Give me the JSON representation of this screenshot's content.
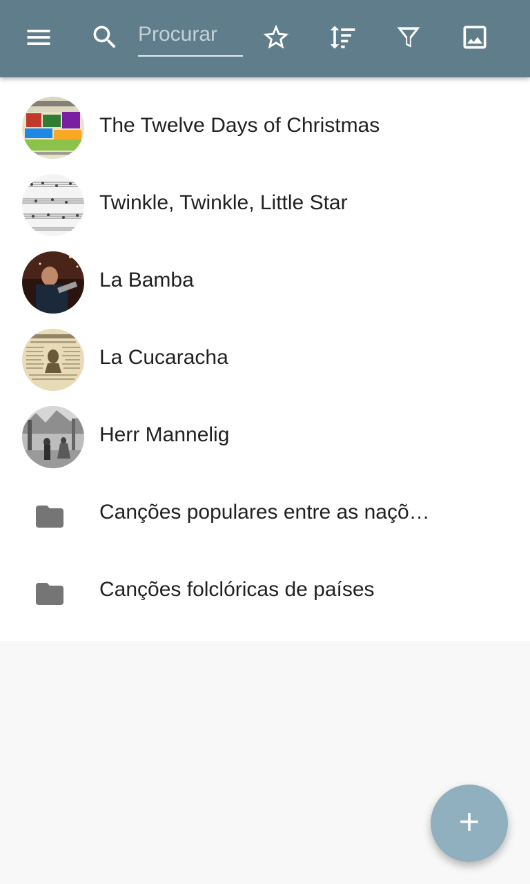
{
  "toolbar": {
    "menu_icon": "menu-icon",
    "search_icon": "search-icon",
    "search_placeholder": "Procurar",
    "search_value": "",
    "favorite_icon": "star-outline-icon",
    "sort_icon": "sort-icon",
    "filter_icon": "filter-icon",
    "image_icon": "image-icon",
    "background_color": "#607d8b"
  },
  "list": {
    "items": [
      {
        "label": "The Twelve Days of Christmas",
        "kind": "song",
        "thumbnail": "colorful-illustration"
      },
      {
        "label": "Twinkle, Twinkle, Little Star",
        "kind": "song",
        "thumbnail": "sheet-music"
      },
      {
        "label": "La Bamba",
        "kind": "song",
        "thumbnail": "performer-photo"
      },
      {
        "label": "La Cucaracha",
        "kind": "song",
        "thumbnail": "broadside-print"
      },
      {
        "label": "Herr Mannelig",
        "kind": "song",
        "thumbnail": "engraving"
      },
      {
        "label": "Canções populares entre as nações",
        "kind": "folder",
        "icon": "folder-icon"
      },
      {
        "label": "Canções folclóricas de países",
        "kind": "folder",
        "icon": "folder-icon"
      }
    ]
  },
  "fab": {
    "icon": "plus-icon",
    "color": "#90afbf"
  }
}
